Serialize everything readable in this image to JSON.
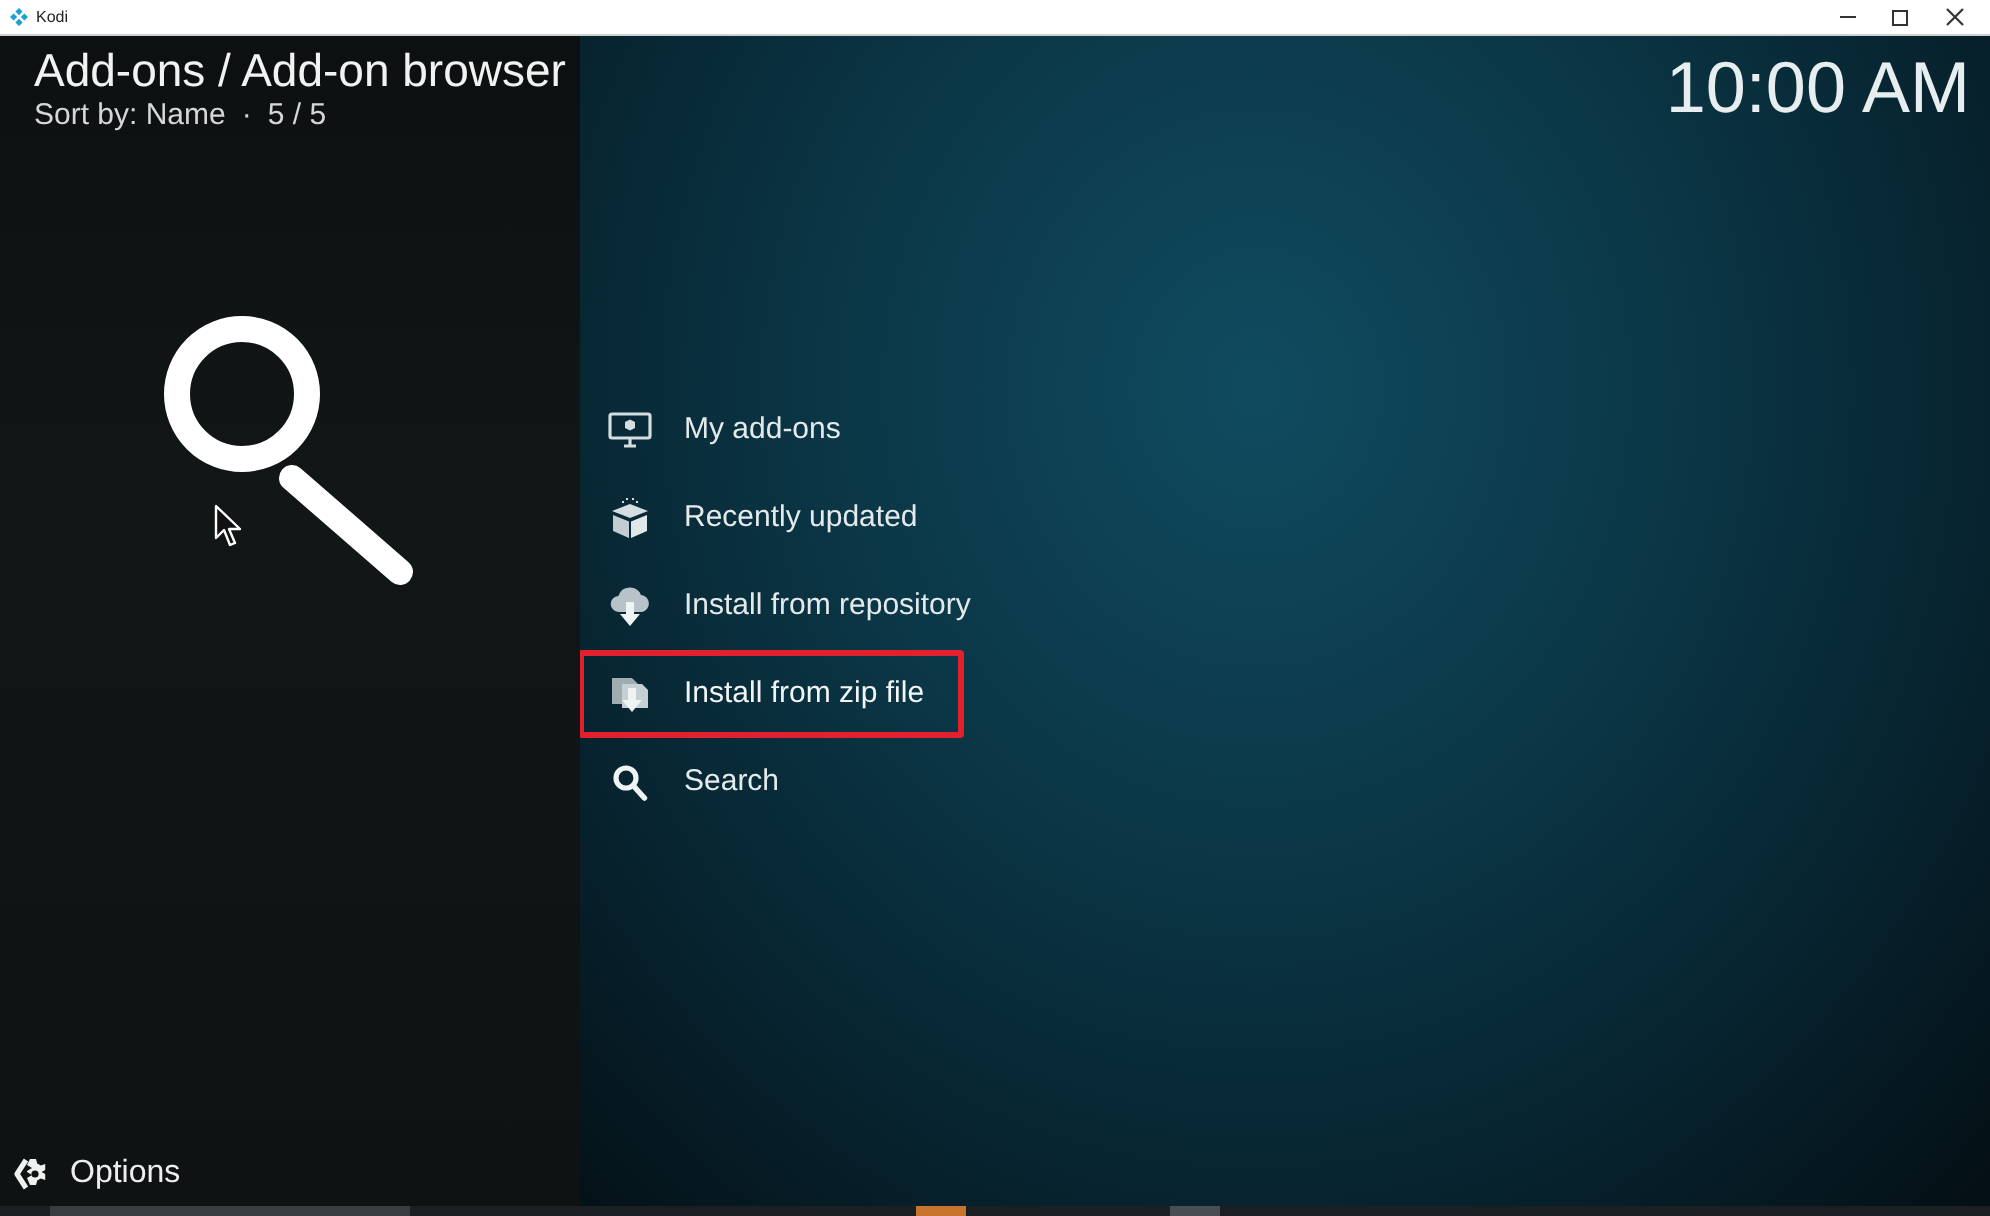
{
  "window": {
    "title": "Kodi"
  },
  "header": {
    "title": "Add-ons / Add-on browser",
    "sort_label": "Sort by: Name",
    "separator": "·",
    "count": "5 / 5"
  },
  "clock": "10:00 AM",
  "menu": [
    {
      "kind": "monitor",
      "label": "My add-ons",
      "selected": false
    },
    {
      "kind": "box",
      "label": "Recently updated",
      "selected": false
    },
    {
      "kind": "cloud",
      "label": "Install from repository",
      "selected": false
    },
    {
      "kind": "zip",
      "label": "Install from zip file",
      "selected": true
    },
    {
      "kind": "search",
      "label": "Search",
      "selected": false
    }
  ],
  "footer": {
    "options_label": "Options"
  }
}
